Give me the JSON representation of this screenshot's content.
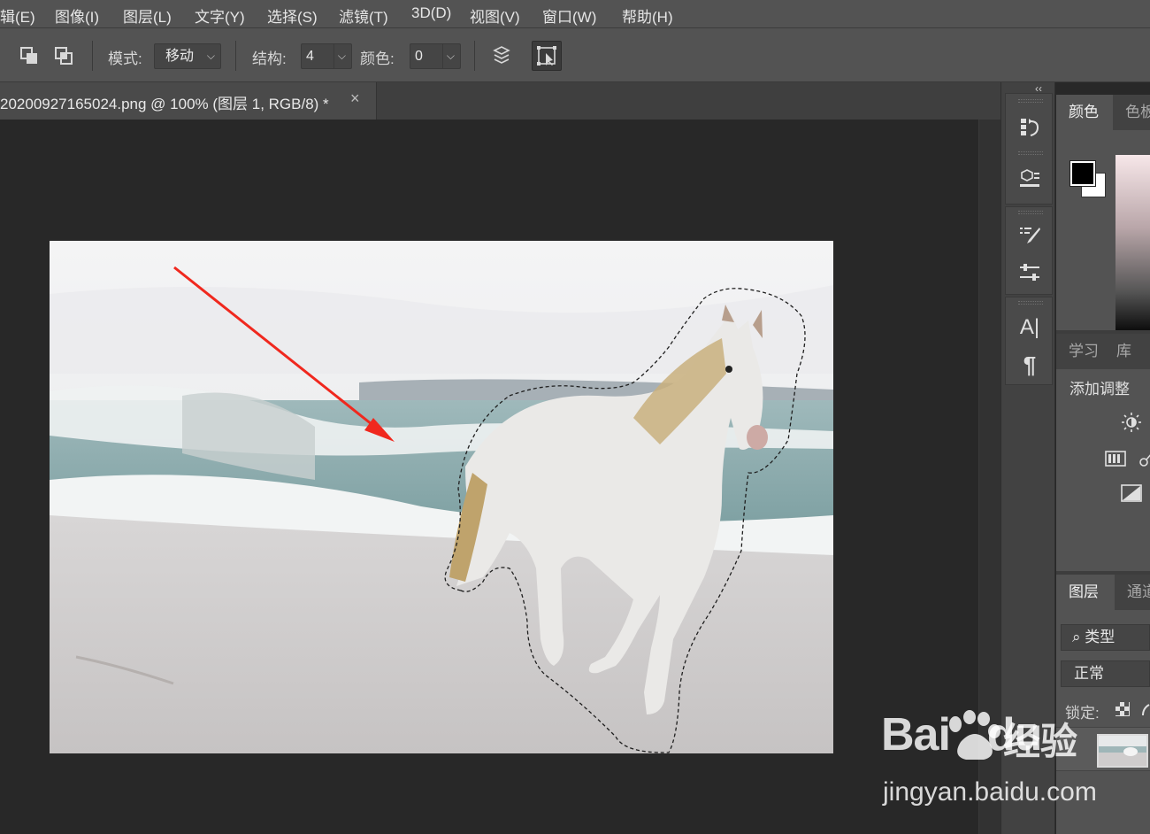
{
  "menu": [
    "辑(E)",
    "图像(I)",
    "图层(L)",
    "文字(Y)",
    "选择(S)",
    "滤镜(T)",
    "3D(D)",
    "视图(V)",
    "窗口(W)",
    "帮助(H)"
  ],
  "options": {
    "mode_label": "模式:",
    "mode_value": "移动",
    "structure_label": "结构:",
    "structure_value": "4",
    "color_label": "颜色:",
    "color_value": "0"
  },
  "document": {
    "tab_title": "20200927165024.png @ 100% (图层 1, RGB/8) *",
    "close_glyph": "×"
  },
  "dock": {
    "collapse_glyph": "‹‹",
    "icons": [
      "history-icon",
      "3d-icon",
      "brush-settings-icon",
      "adjust-brush-icon",
      "character-icon",
      "paragraph-icon"
    ]
  },
  "color_panel": {
    "tabs": [
      "颜色",
      "色板"
    ],
    "foreground": "#000000",
    "background": "#ffffff"
  },
  "adjust_panel": {
    "tabs": [
      "学习",
      "库"
    ],
    "title": "添加调整"
  },
  "layers_panel": {
    "tabs": [
      "图层",
      "通道"
    ],
    "search": "类型",
    "blend_mode": "正常",
    "lock_label": "锁定:"
  },
  "watermark": {
    "brand": "Bai",
    "brand2": "du",
    "jingyan": "经验",
    "url": "jingyan.baidu.com"
  }
}
